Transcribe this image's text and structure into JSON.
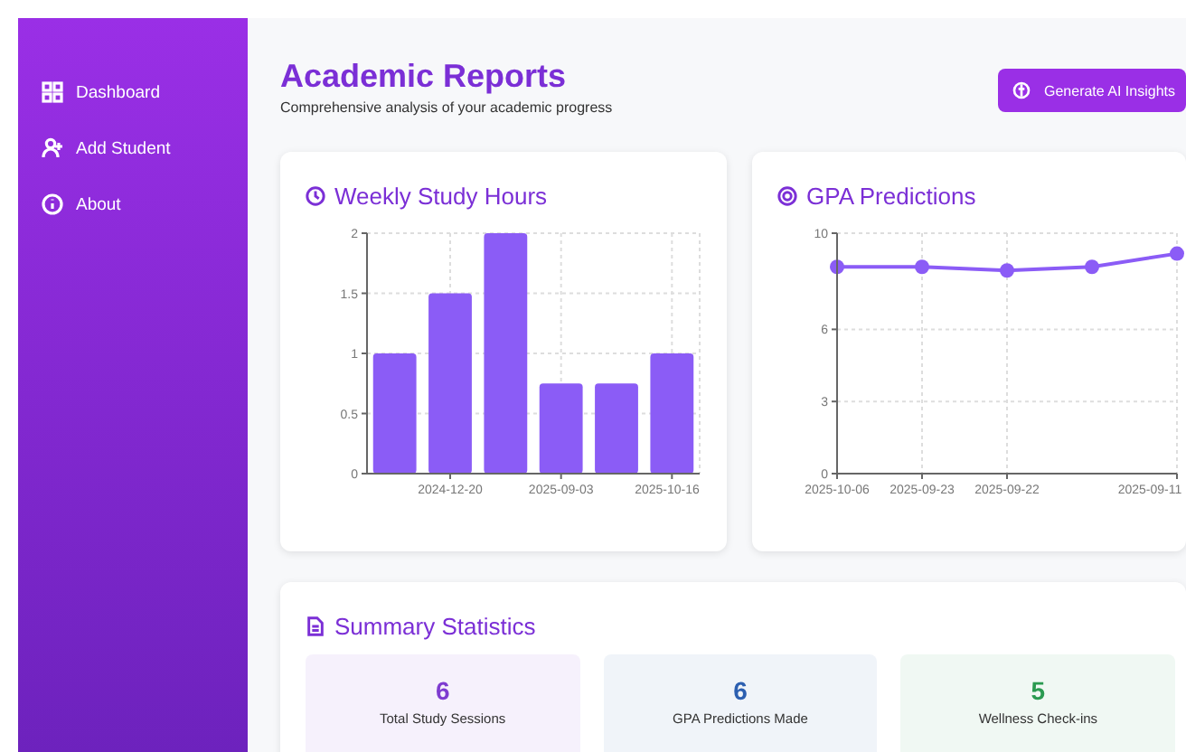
{
  "sidebar": {
    "items": [
      {
        "label": "Dashboard"
      },
      {
        "label": "Add Student"
      },
      {
        "label": "About"
      }
    ]
  },
  "header": {
    "title": "Academic Reports",
    "subtitle": "Comprehensive analysis of your academic progress",
    "button": "Generate AI Insights"
  },
  "charts": [
    {
      "title": "Weekly Study Hours",
      "chart_data": {
        "type": "bar",
        "grid": true,
        "ylim": [
          0,
          2
        ],
        "yticks": [
          0,
          0.5,
          1,
          1.5,
          2
        ],
        "categories": [
          null,
          "2024-12-20",
          null,
          "2025-09-03",
          null,
          "2025-10-16"
        ],
        "series": [
          {
            "color": "#8b5cf6",
            "values": [
              1,
              1.5,
              2,
              0.75,
              0.75,
              1
            ]
          }
        ]
      }
    },
    {
      "title": "GPA Predictions",
      "chart_data": {
        "type": "line",
        "grid": true,
        "ylim": [
          0,
          10
        ],
        "yticks": [
          0,
          3,
          6,
          10
        ],
        "categories": [
          "2025-10-06",
          "2025-09-23",
          "2025-09-22",
          null,
          "2025-09-11"
        ],
        "series": [
          {
            "color": "#8b5cf6",
            "marker": true,
            "values": [
              8.6,
              8.6,
              8.45,
              8.6,
              9.15
            ]
          }
        ]
      }
    }
  ],
  "summary": {
    "title": "Summary Statistics",
    "stats": [
      {
        "value": "6",
        "label": "Total Study Sessions",
        "color": "#7e3bd0"
      },
      {
        "value": "6",
        "label": "GPA Predictions Made",
        "color": "#2c5fb0"
      },
      {
        "value": "5",
        "label": "Wellness Check-ins",
        "color": "#2a9a50"
      }
    ]
  }
}
